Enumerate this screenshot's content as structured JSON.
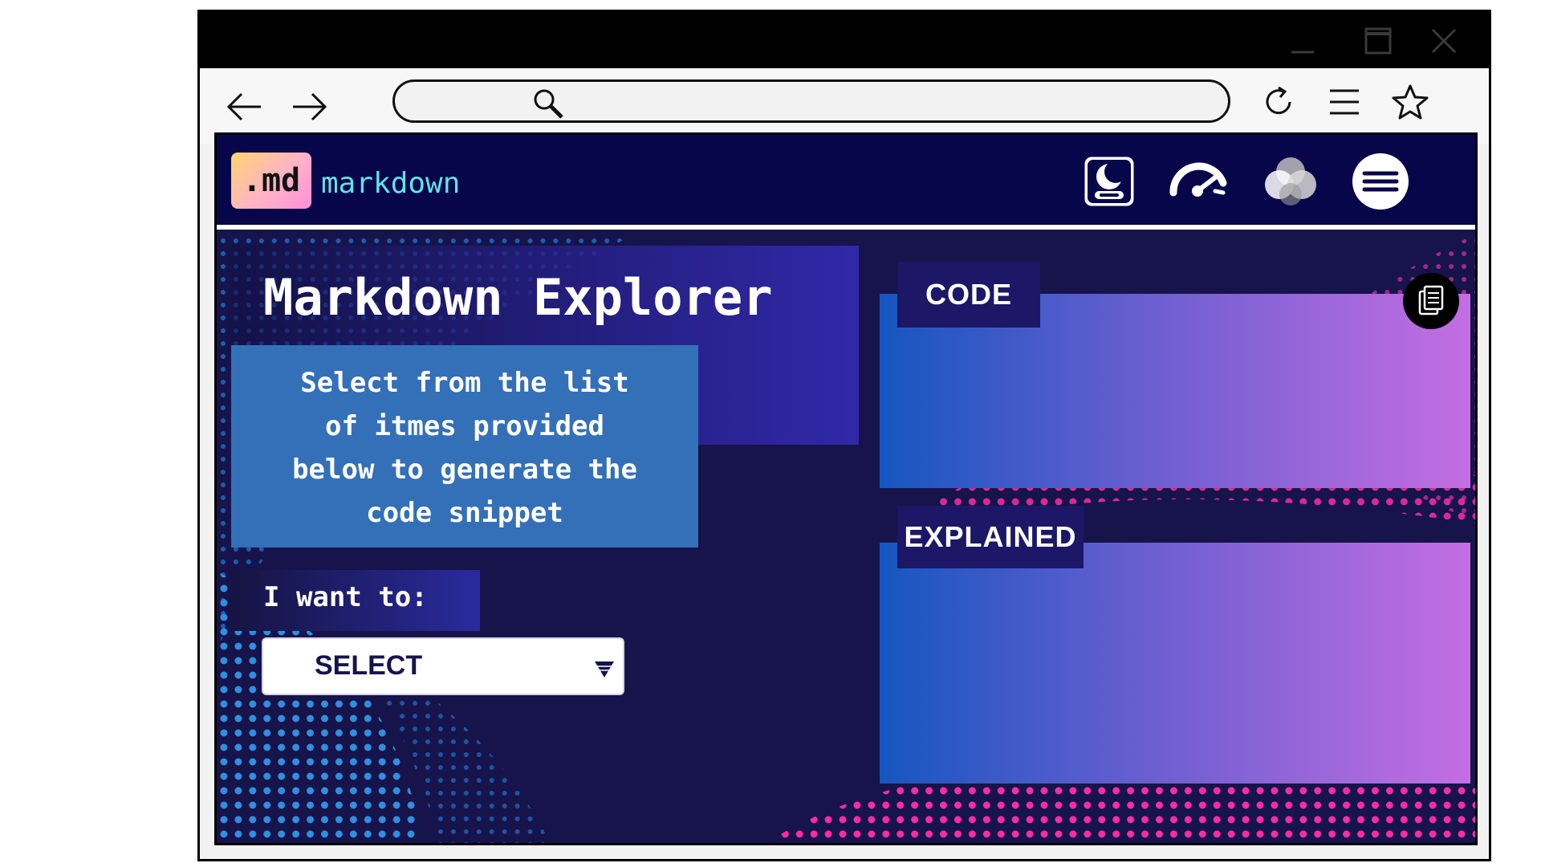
{
  "browser": {
    "address_value": "",
    "address_placeholder": ""
  },
  "header": {
    "logo_badge": ".md",
    "logo_text": "markdown",
    "icons": [
      "theme-toggle-icon",
      "speedometer-icon",
      "color-circles-icon",
      "hamburger-menu-icon"
    ]
  },
  "main": {
    "title": "Markdown Explorer",
    "instruction_lines": [
      "Select from the list",
      "of itmes provided",
      "below to generate the",
      "code snippet"
    ],
    "want_label": "I want to:",
    "select_value": "SELECT"
  },
  "panels": {
    "code_label": "CODE",
    "explained_label": "EXPLAINED"
  },
  "colors": {
    "header_bg": "#08064a",
    "accent_cyan": "#5fe3e8",
    "instruction_bg": "#3470b8",
    "panel_gradient_start": "#1656c0",
    "panel_gradient_end": "#c46ee2",
    "tab_bg": "#1c1766"
  }
}
